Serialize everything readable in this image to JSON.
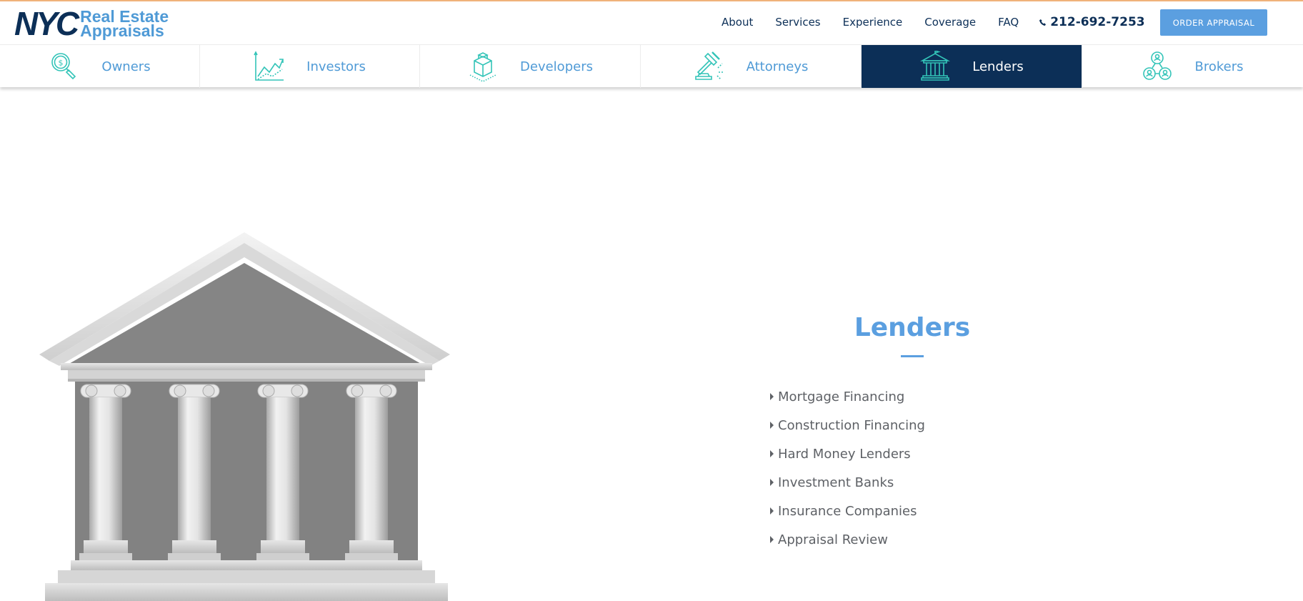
{
  "logo": {
    "main": "NYC",
    "line1": "Real Estate",
    "line2": "Appraisals"
  },
  "nav": {
    "links": [
      "About",
      "Services",
      "Experience",
      "Coverage",
      "FAQ"
    ],
    "phone": "212-692-7253",
    "order_button": "ORDER APPRAISAL"
  },
  "tabs": [
    {
      "label": "Owners",
      "icon": "magnifier-dollar-icon",
      "active": false
    },
    {
      "label": "Investors",
      "icon": "growth-chart-icon",
      "active": false
    },
    {
      "label": "Developers",
      "icon": "cube-icon",
      "active": false
    },
    {
      "label": "Attorneys",
      "icon": "gavel-icon",
      "active": true
    },
    {
      "label": "Lenders",
      "icon": "bank-icon",
      "active": true
    },
    {
      "label": "Brokers",
      "icon": "people-network-icon",
      "active": false
    }
  ],
  "colors": {
    "navy": "#0c2f57",
    "accent_blue": "#5b9fe0",
    "teal_icon": "#33c4b8",
    "text_gray": "#5e6166"
  },
  "main": {
    "title": "Lenders",
    "items": [
      "Mortgage Financing",
      "Construction Financing",
      "Hard Money Lenders",
      "Investment Banks",
      "Insurance Companies",
      "Appraisal Review"
    ]
  }
}
